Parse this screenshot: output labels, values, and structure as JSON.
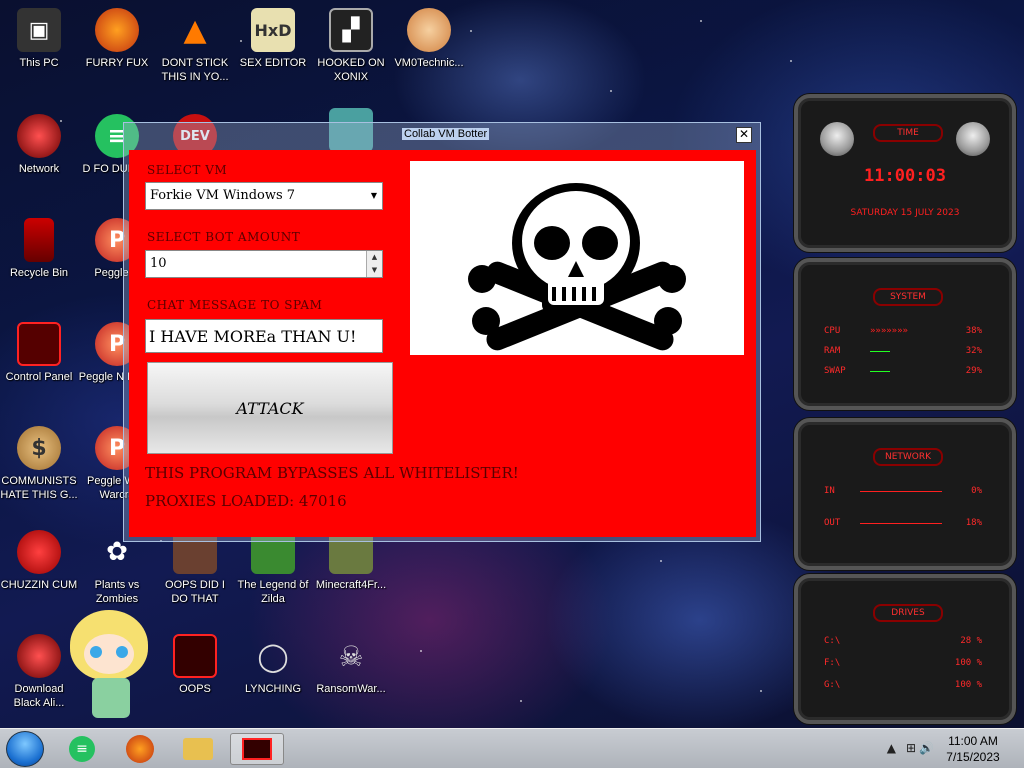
{
  "desktop": {
    "icons": [
      {
        "label": "This PC"
      },
      {
        "label": "FURRY FUX"
      },
      {
        "label": "DONT STICK THIS IN YO..."
      },
      {
        "label": "SEX EDITOR"
      },
      {
        "label": "HOOKED ON XONIX"
      },
      {
        "label": "VM0Technic..."
      },
      {
        "label": "Network"
      },
      {
        "label": "D FO DUMBA"
      },
      {
        "label": "Recycle Bin"
      },
      {
        "label": "Peggle D"
      },
      {
        "label": "Control Panel"
      },
      {
        "label": "Peggle N Delux"
      },
      {
        "label": "COMMUNISTS HATE THIS G..."
      },
      {
        "label": "Peggle W of Warcra"
      },
      {
        "label": "CHUZZIN CUM"
      },
      {
        "label": "Plants vs Zombies"
      },
      {
        "label": "OOPS DID I DO THAT"
      },
      {
        "label": "The Legend of Zilda"
      },
      {
        "label": "Minecraft4Fr..."
      },
      {
        "label": "Download Black Ali..."
      },
      {
        "label": "OOPS"
      },
      {
        "label": "LYNCHING"
      },
      {
        "label": "RansomWar..."
      }
    ],
    "partial_icon_labels": {
      "dev": "DEV"
    }
  },
  "app": {
    "title": "Collab VM Botter",
    "close_symbol": "✕",
    "select_vm_label": "SELECT VM",
    "select_vm_value": "Forkie VM Windows 7",
    "bot_amount_label": "SELECT BOT AMOUNT",
    "bot_amount_value": "10",
    "chat_label": "CHAT MESSAGE TO SPAM",
    "chat_value": "I HAVE MOREa THAN U!",
    "attack_label": "ATTACK",
    "note1": "THIS PROGRAM BYPASSES ALL WHITELISTER!",
    "note2": "PROXIES LOADED: 47016"
  },
  "widgets": {
    "time": {
      "title": "TIME",
      "clock": "11:00:03",
      "date": "SATURDAY 15 JULY 2023"
    },
    "system": {
      "title": "SYSTEM",
      "rows": [
        {
          "name": "CPU",
          "value": "38%"
        },
        {
          "name": "RAM",
          "value": "32%"
        },
        {
          "name": "SWAP",
          "value": "29%"
        }
      ]
    },
    "network": {
      "title": "NETWORK",
      "rows": [
        {
          "name": "IN",
          "value": "0%"
        },
        {
          "name": "OUT",
          "value": "18%"
        }
      ]
    },
    "drives": {
      "title": "DRIVES",
      "rows": [
        {
          "name": "C:\\",
          "value": "28 %"
        },
        {
          "name": "F:\\",
          "value": "100 %"
        },
        {
          "name": "G:\\",
          "value": "100 %"
        }
      ]
    }
  },
  "taskbar": {
    "clock_time": "11:00 AM",
    "clock_date": "7/15/2023"
  },
  "colors": {
    "window_red": "#ff0000",
    "label_dark_red": "#5a0000",
    "widget_red": "#ff2a2a"
  }
}
